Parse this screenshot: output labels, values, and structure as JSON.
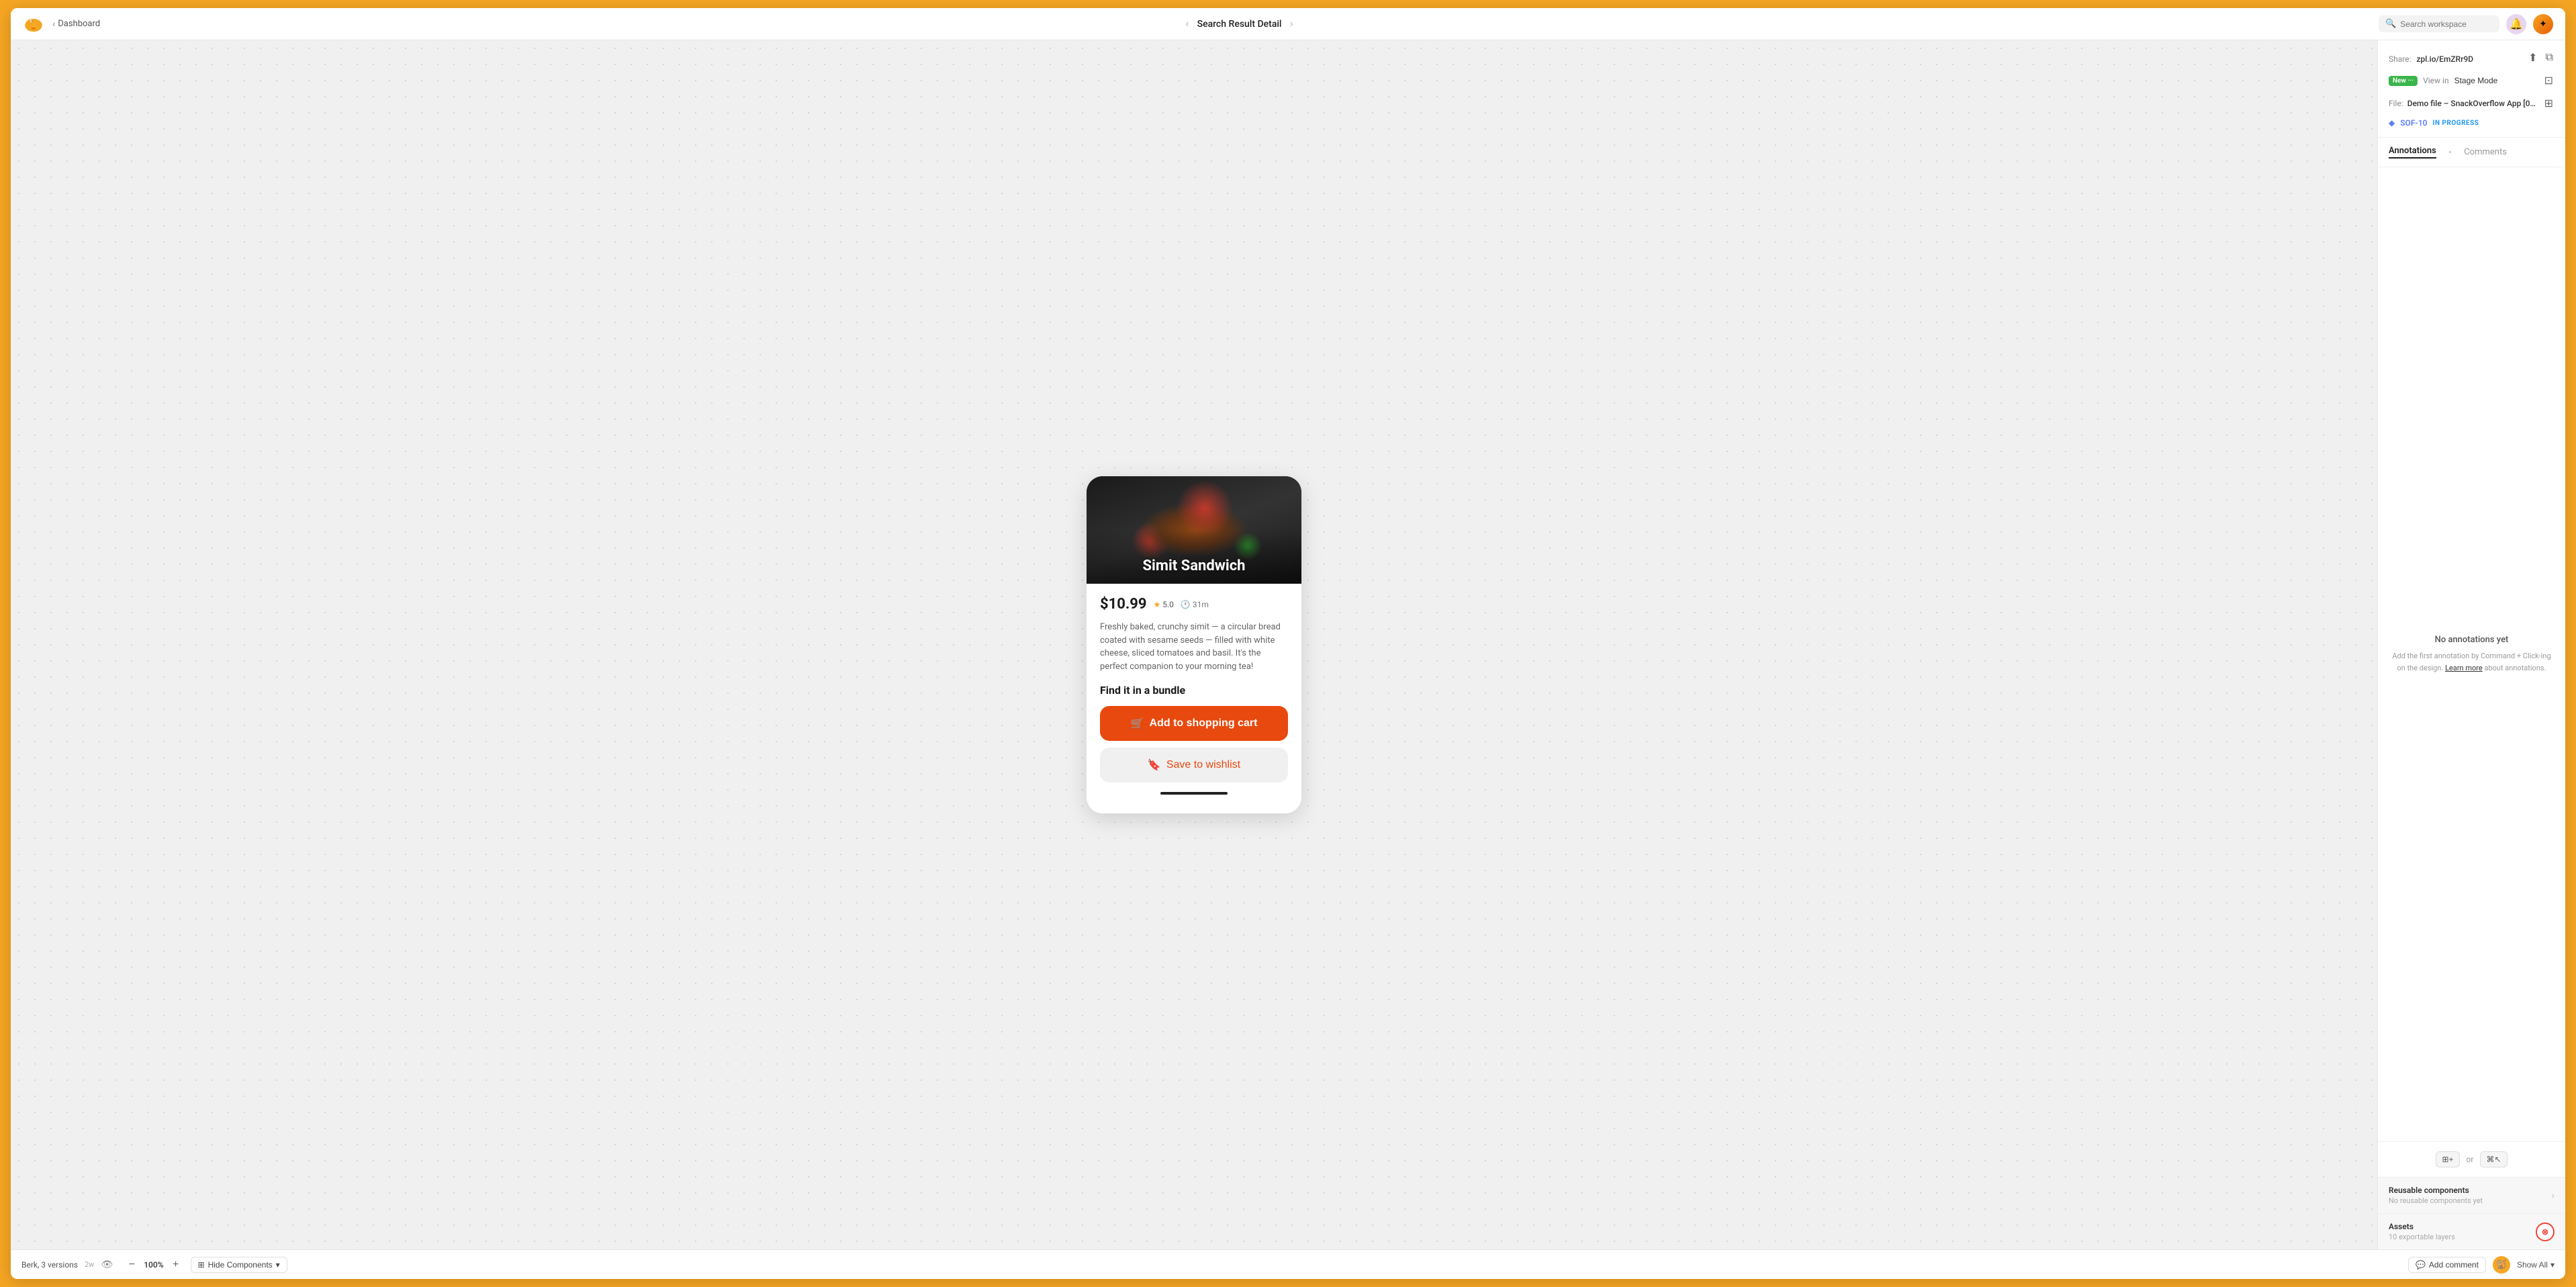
{
  "header": {
    "back_label": "Dashboard",
    "title": "Search Result Detail",
    "search_placeholder": "Search workspace",
    "notification_icon": "🔔",
    "avatar_icon": "🌟"
  },
  "share": {
    "label": "Share:",
    "link": "zpl.io/EmZRr9D",
    "new_badge": "New ···",
    "view_in_label": "View in",
    "stage_mode": "Stage Mode",
    "file_label": "File:",
    "file_name": "Demo file – SnackOverflow App [0…",
    "ticket_id": "SOF-10",
    "status": "IN PROGRESS"
  },
  "annotations": {
    "tab_annotations": "Annotations",
    "tab_comments": "Comments",
    "empty_title": "No annotations yet",
    "empty_desc": "Add the first annotation by Command + Click-ing on the design.",
    "learn_more": "Learn more",
    "empty_desc2": "about annotations.",
    "shortcut1": "⊞+",
    "shortcut_or": "or",
    "shortcut2": "⌘↖"
  },
  "reusable": {
    "title": "Reusable components",
    "subtitle": "No reusable components yet"
  },
  "assets": {
    "title": "Assets",
    "subtitle": "10 exportable layers",
    "sos_label": "⊗"
  },
  "card": {
    "food_title": "Simit Sandwich",
    "price": "$10.99",
    "rating": "5.0",
    "time": "31m",
    "description": "Freshly baked, crunchy simit — a circular bread coated with sesame seeds — filled with white cheese, sliced tomatoes and basil. It's the perfect companion to your morning tea!",
    "bundle_label": "Find it in a bundle",
    "cart_btn": "Add to shopping cart",
    "wishlist_btn": "Save to wishlist"
  },
  "bottombar": {
    "user": "Berk, 3 versions",
    "time": "2w",
    "zoom": "100%",
    "components_btn": "Hide Components",
    "add_comment": "Add comment",
    "show_all": "Show All"
  }
}
